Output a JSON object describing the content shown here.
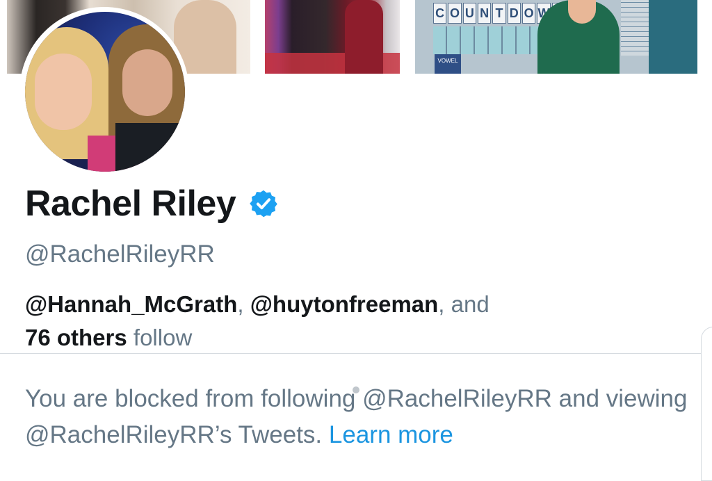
{
  "header_photos": {
    "photo_3_sign": "COUNTDOWN",
    "photo_3_vowel_label": "VOWEL"
  },
  "profile": {
    "name": "Rachel Riley",
    "verified": true,
    "handle": "@RachelRileyRR"
  },
  "followers_you_know": {
    "user_1": "@Hannah_McGrath",
    "sep_1": ", ",
    "user_2": "@huytonfreeman",
    "sep_2": ", and",
    "others": "76 others",
    "suffix": " follow"
  },
  "blocked_notice": {
    "text": "You are blocked from following @RachelRileyRR and viewing @RachelRileyRR’s Tweets. ",
    "link": "Learn more"
  },
  "colors": {
    "verified_badge": "#1da1f2",
    "link": "#1b95e0",
    "secondary_text": "#657786"
  }
}
